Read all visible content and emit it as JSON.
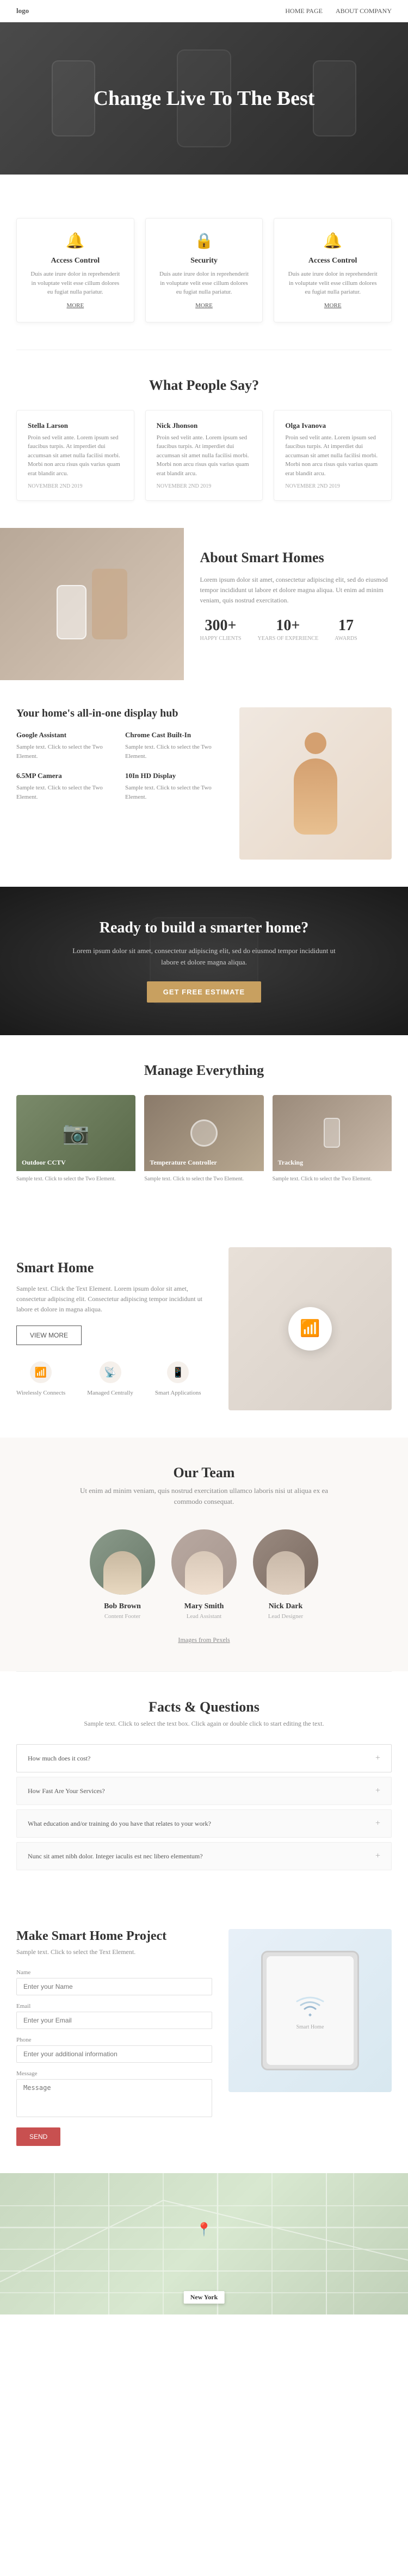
{
  "nav": {
    "logo": "logo",
    "links": [
      {
        "label": "HOME PAGE",
        "href": "#"
      },
      {
        "label": "ABOUT COMPANY",
        "href": "#"
      }
    ]
  },
  "hero": {
    "title": "Change Live To The Best"
  },
  "features": {
    "title": "",
    "cards": [
      {
        "icon": "🔔",
        "title": "Access Control",
        "description": "Duis aute irure dolor in reprehenderit in voluptate velit esse cillum dolores eu fugiat nulla pariatur.",
        "more_label": "MORE"
      },
      {
        "icon": "🔒",
        "title": "Security",
        "description": "Duis aute irure dolor in reprehenderit in voluptate velit esse cillum dolores eu fugiat nulla pariatur.",
        "more_label": "MORE"
      },
      {
        "icon": "🔔",
        "title": "Access Control",
        "description": "Duis aute irure dolor in reprehenderit in voluptate velit esse cillum dolores eu fugiat nulla pariatur.",
        "more_label": "MORE"
      }
    ]
  },
  "testimonials": {
    "title": "What People Say?",
    "items": [
      {
        "name": "Stella Larson",
        "text": "Proin sed velit ante. Lorem ipsum sed faucibus turpis. At imperdiet dui accumsan sit amet nulla facilisi morbi. Morbi non arcu risus quis varius quam erat blandit arcu.",
        "date": "NOVEMBER 2ND 2019"
      },
      {
        "name": "Nick Jhonson",
        "text": "Proin sed velit ante. Lorem ipsum sed faucibus turpis. At imperdiet dui accumsan sit amet nulla facilisi morbi. Morbi non arcu risus quis varius quam erat blandit arcu.",
        "date": "NOVEMBER 2ND 2019"
      },
      {
        "name": "Olga Ivanova",
        "text": "Proin sed velit ante. Lorem ipsum sed faucibus turpis. At imperdiet dui accumsan sit amet nulla facilisi morbi. Morbi non arcu risus quis varius quam erat blandit arcu.",
        "date": "NOVEMBER 2ND 2019"
      }
    ]
  },
  "about": {
    "title": "About Smart Homes",
    "description": "Lorem ipsum dolor sit amet, consectetur adipiscing elit, sed do eiusmod tempor incididunt ut labore et dolore magna aliqua. Ut enim ad minim veniam, quis nostrud exercitation.",
    "stats": [
      {
        "number": "300+",
        "label": "HAPPY CLIENTS"
      },
      {
        "number": "10+",
        "label": "YEARS OF EXPERIENCE"
      },
      {
        "number": "17",
        "label": "AWARDS"
      }
    ]
  },
  "allinone": {
    "title": "Your home's all-in-one display hub",
    "features": [
      {
        "title": "Google Assistant",
        "description": "Sample text. Click to select the Two Element."
      },
      {
        "title": "Chrome Cast Built-In",
        "description": "Sample text. Click to select the Two Element."
      },
      {
        "title": "6.5MP Camera",
        "description": "Sample text. Click to select the Two Element."
      },
      {
        "title": "10In HD Display",
        "description": "Sample text. Click to select the Two Element."
      }
    ]
  },
  "cta": {
    "title": "Ready to build a smarter home?",
    "description": "Lorem ipsum dolor sit amet, consectetur adipiscing elit, sed do eiusmod tempor incididunt ut labore et dolore magna aliqua.",
    "button_label": "GET FREE ESTIMATE"
  },
  "manage": {
    "title": "Manage Everything",
    "cards": [
      {
        "title": "Outdoor CCTV",
        "description": "Sample text. Click to select the Two Element."
      },
      {
        "title": "Temperature Controller",
        "description": "Sample text. Click to select the Two Element."
      },
      {
        "title": "Tracking",
        "description": "Sample text. Click to select the Two Element."
      }
    ]
  },
  "smarthome": {
    "title": "Smart Home",
    "description": "Sample text. Click the Text Element. Lorem ipsum dolor sit amet, consectetur adipiscing elit. Consectetur adipiscing tempor incididunt ut labore et dolore in magna aliqua.",
    "button_label": "VIEW MORE",
    "icons": [
      {
        "icon": "📶",
        "label": "Wirelessly Connects"
      },
      {
        "icon": "📡",
        "label": "Managed Centrally"
      },
      {
        "icon": "📱",
        "label": "Smart Applications"
      }
    ]
  },
  "team": {
    "title": "Our Team",
    "intro": "Ut enim ad minim veniam, quis nostrud exercitation ullamco laboris nisi ut aliqua ex ea commodo consequat.",
    "members": [
      {
        "name": "Bob Brown",
        "role": "Content Footer"
      },
      {
        "name": "Mary Smith",
        "role": "Lead Assistant"
      },
      {
        "name": "Nick Dark",
        "role": "Lead Designer"
      }
    ],
    "link_label": "Images from Pexels"
  },
  "faq": {
    "title": "Facts & Questions",
    "intro": "Sample text. Click to select the text box. Click again or double click to start editing the text.",
    "items": [
      {
        "question": "How much does it cost?"
      },
      {
        "question": "How Fast Are Your Services?"
      },
      {
        "question": "What education and/or training do you have that relates to your work?"
      },
      {
        "question": "Nunc sit amet nibh dolor. Integer iaculis est nec libero elementum?"
      }
    ]
  },
  "project": {
    "title": "Make Smart Home Project",
    "intro": "Sample text. Click to select the Text Element.",
    "form": {
      "name_label": "Name",
      "name_placeholder": "Enter your Name",
      "email_label": "Email",
      "email_placeholder": "Enter your Email",
      "phone_label": "Phone",
      "phone_placeholder": "Enter your additional information",
      "message_label": "Message",
      "message_placeholder": "Message",
      "submit_label": "SEND"
    }
  },
  "map": {
    "city_label": "New York"
  }
}
